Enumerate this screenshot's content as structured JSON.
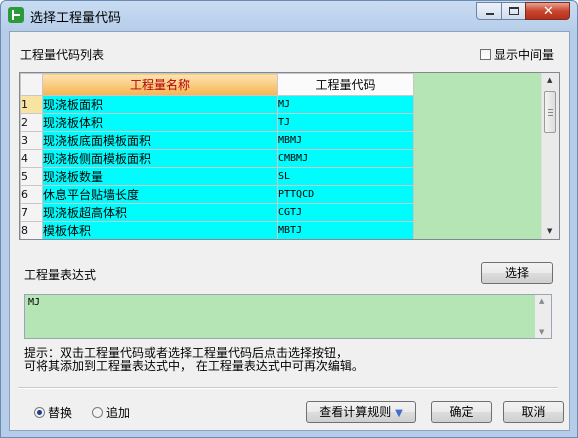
{
  "window": {
    "title": "选择工程量代码"
  },
  "list": {
    "title": "工程量代码列表",
    "show_middle_label": "显示中间量",
    "columns": [
      "工程量名称",
      "工程量代码"
    ],
    "rows": [
      {
        "num": "1",
        "name": "现浇板面积",
        "code": "MJ"
      },
      {
        "num": "2",
        "name": "现浇板体积",
        "code": "TJ"
      },
      {
        "num": "3",
        "name": "现浇板底面模板面积",
        "code": "MBMJ"
      },
      {
        "num": "4",
        "name": "现浇板侧面模板面积",
        "code": "CMBMJ"
      },
      {
        "num": "5",
        "name": "现浇板数量",
        "code": "SL"
      },
      {
        "num": "6",
        "name": "休息平台贴墙长度",
        "code": "PTTQCD"
      },
      {
        "num": "7",
        "name": "现浇板超高体积",
        "code": "CGTJ"
      },
      {
        "num": "8",
        "name": "模板体积",
        "code": "MBTJ"
      }
    ]
  },
  "expression": {
    "label": "工程量表达式",
    "select_button": "选择",
    "value": "MJ"
  },
  "hint": {
    "line1": "提示：双击工程量代码或者选择工程量代码后点击选择按钮，",
    "line2": "可将其添加到工程量表达式中，  在工程量表达式中可再次编辑。"
  },
  "mode": {
    "options": [
      "替换",
      "追加"
    ],
    "selected": "替换"
  },
  "buttons": {
    "rules": "查看计算规则",
    "ok": "确定",
    "cancel": "取消"
  }
}
